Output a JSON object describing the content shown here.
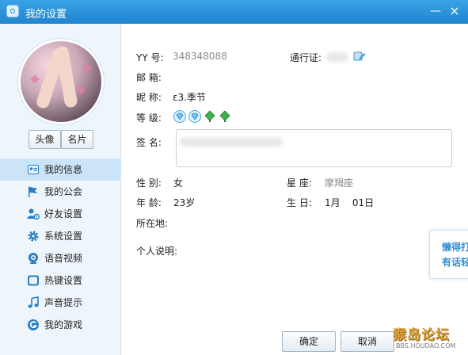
{
  "window": {
    "title": "我的设置",
    "min_glyph": "—",
    "close_glyph": "×"
  },
  "sidebar": {
    "avatar_button": "头像",
    "card_button": "名片",
    "items": [
      {
        "label": "我的信息",
        "icon": "info-card-icon",
        "active": true
      },
      {
        "label": "我的公会",
        "icon": "flag-icon",
        "active": false
      },
      {
        "label": "好友设置",
        "icon": "friends-settings-icon",
        "active": false
      },
      {
        "label": "系统设置",
        "icon": "gear-icon",
        "active": false
      },
      {
        "label": "语音视频",
        "icon": "webcam-icon",
        "active": false
      },
      {
        "label": "热键设置",
        "icon": "keyboard-icon",
        "active": false
      },
      {
        "label": "声音提示",
        "icon": "music-note-icon",
        "active": false
      },
      {
        "label": "我的游戏",
        "icon": "game-g-icon",
        "active": false
      }
    ]
  },
  "profile": {
    "yy_label": "YY  号:",
    "yy_value": "348348088",
    "pass_label": "通行证:",
    "email_label": "邮  箱:",
    "email_value": "",
    "nick_label": "昵  称:",
    "nick_value": "ε3.季节",
    "level_label": "等  级:",
    "sign_label": "签  名:",
    "gender_label": "性  别:",
    "gender_value": "女",
    "star_label": "星  座:",
    "star_value": "摩羯座",
    "age_label": "年  龄:",
    "age_value": "23岁",
    "birthday_label": "生  日:",
    "birthday_value": "1月    01日",
    "location_label": "所在地:",
    "location_value": "",
    "intro_label": "个人说明:",
    "intro_value": ""
  },
  "popup": {
    "line1": "懒得打",
    "line2": "有话轻"
  },
  "footer": {
    "ok_label": "确定",
    "cancel_label": "取消"
  },
  "watermark": {
    "text": "猴岛论坛",
    "url": "BBS.HOUDAO.COM"
  },
  "colors": {
    "titlebar": "#2185d0",
    "sidebar_bg": "#eef6fc",
    "active_item": "#cce4f7",
    "accent_blue": "#2f8fd8"
  }
}
